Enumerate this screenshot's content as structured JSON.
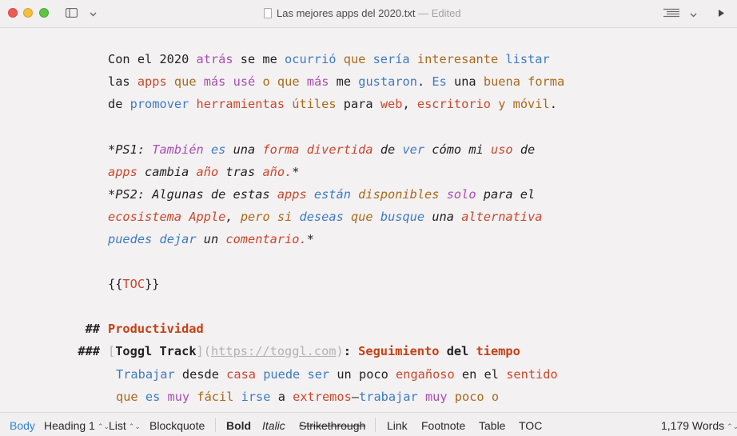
{
  "window": {
    "title": "Las mejores apps del 2020.txt",
    "title_sep": "—",
    "edited": "Edited"
  },
  "colors": {
    "purple": "#a84eb0",
    "blue": "#3c7bc0",
    "ochre": "#a86a18",
    "red": "#c9482a",
    "heading": "#c34113",
    "accent": "#2f86d6"
  },
  "editor": {
    "p1_l1": [
      {
        "t": "Con el 2020 "
      },
      {
        "t": "atrás",
        "c": "p"
      },
      {
        "t": " se me "
      },
      {
        "t": "ocurrió",
        "c": "b"
      },
      {
        "t": " "
      },
      {
        "t": "que",
        "c": "o"
      },
      {
        "t": " "
      },
      {
        "t": "sería",
        "c": "b"
      },
      {
        "t": " "
      },
      {
        "t": "interesante",
        "c": "o"
      },
      {
        "t": " "
      },
      {
        "t": "listar",
        "c": "b"
      }
    ],
    "p1_l2": [
      {
        "t": "las "
      },
      {
        "t": "apps",
        "c": "r"
      },
      {
        "t": " "
      },
      {
        "t": "que",
        "c": "o"
      },
      {
        "t": " "
      },
      {
        "t": "más",
        "c": "p"
      },
      {
        "t": " "
      },
      {
        "t": "usé",
        "c": "p"
      },
      {
        "t": " "
      },
      {
        "t": "o",
        "c": "o"
      },
      {
        "t": " "
      },
      {
        "t": "que",
        "c": "o"
      },
      {
        "t": " "
      },
      {
        "t": "más",
        "c": "p"
      },
      {
        "t": " me "
      },
      {
        "t": "gustaron",
        "c": "b"
      },
      {
        "t": ". "
      },
      {
        "t": "Es",
        "c": "b"
      },
      {
        "t": " una "
      },
      {
        "t": "buena",
        "c": "o"
      },
      {
        "t": " "
      },
      {
        "t": "forma",
        "c": "o"
      }
    ],
    "p1_l3": [
      {
        "t": "de "
      },
      {
        "t": "promover",
        "c": "b"
      },
      {
        "t": " "
      },
      {
        "t": "herramientas",
        "c": "r"
      },
      {
        "t": " "
      },
      {
        "t": "útiles",
        "c": "o"
      },
      {
        "t": " para "
      },
      {
        "t": "web",
        "c": "r"
      },
      {
        "t": ", "
      },
      {
        "t": "escritorio",
        "c": "r"
      },
      {
        "t": " "
      },
      {
        "t": "y",
        "c": "o"
      },
      {
        "t": " "
      },
      {
        "t": "móvil",
        "c": "o"
      },
      {
        "t": "."
      }
    ],
    "ps1_l1": [
      {
        "t": "*PS1: "
      },
      {
        "t": "También",
        "c": "p"
      },
      {
        "t": " "
      },
      {
        "t": "es",
        "c": "b"
      },
      {
        "t": " una "
      },
      {
        "t": "forma",
        "c": "r"
      },
      {
        "t": " "
      },
      {
        "t": "divertida",
        "c": "r"
      },
      {
        "t": " de "
      },
      {
        "t": "ver",
        "c": "b"
      },
      {
        "t": " cómo mi "
      },
      {
        "t": "uso",
        "c": "r"
      },
      {
        "t": " de"
      }
    ],
    "ps1_l2": [
      {
        "t": "apps",
        "c": "r"
      },
      {
        "t": " cambia "
      },
      {
        "t": "año",
        "c": "r"
      },
      {
        "t": " tras "
      },
      {
        "t": "año.",
        "c": "r"
      },
      {
        "t": "*"
      }
    ],
    "ps2_l1": [
      {
        "t": "*PS2: Algunas de estas "
      },
      {
        "t": "apps",
        "c": "r"
      },
      {
        "t": " "
      },
      {
        "t": "están",
        "c": "b"
      },
      {
        "t": " "
      },
      {
        "t": "disponibles",
        "c": "o"
      },
      {
        "t": " "
      },
      {
        "t": "solo",
        "c": "p"
      },
      {
        "t": " para el"
      }
    ],
    "ps2_l2": [
      {
        "t": "ecosistema",
        "c": "r"
      },
      {
        "t": " "
      },
      {
        "t": "Apple",
        "c": "r"
      },
      {
        "t": ", "
      },
      {
        "t": "pero",
        "c": "o"
      },
      {
        "t": " "
      },
      {
        "t": "si",
        "c": "o"
      },
      {
        "t": " "
      },
      {
        "t": "deseas",
        "c": "b"
      },
      {
        "t": " "
      },
      {
        "t": "que",
        "c": "o"
      },
      {
        "t": " "
      },
      {
        "t": "busque",
        "c": "b"
      },
      {
        "t": " una "
      },
      {
        "t": "alternativa",
        "c": "r"
      }
    ],
    "ps2_l3": [
      {
        "t": "puedes",
        "c": "b"
      },
      {
        "t": " "
      },
      {
        "t": "dejar",
        "c": "b"
      },
      {
        "t": " un "
      },
      {
        "t": "comentario.",
        "c": "r"
      },
      {
        "t": "*"
      }
    ],
    "toc_open": "{{",
    "toc_word": "TOC",
    "toc_close": "}}",
    "h2_marker": "##",
    "h2_text": "Productividad",
    "h3_marker": "###",
    "h3_link_open": "[",
    "h3_link_text": "Toggl Track",
    "h3_link_mid": "](",
    "h3_link_url": "https://toggl.com",
    "h3_link_close": ")",
    "h3_colon": ": ",
    "h3_w1": "Seguimiento",
    "h3_w2": "del",
    "h3_w3": "tiempo",
    "body_l1": [
      {
        "t": "Trabajar",
        "c": "b"
      },
      {
        "t": " desde "
      },
      {
        "t": "casa",
        "c": "r"
      },
      {
        "t": " "
      },
      {
        "t": "puede",
        "c": "b"
      },
      {
        "t": " "
      },
      {
        "t": "ser",
        "c": "b"
      },
      {
        "t": " un poco "
      },
      {
        "t": "engañoso",
        "c": "r"
      },
      {
        "t": " en el "
      },
      {
        "t": "sentido",
        "c": "r"
      }
    ],
    "body_l2": [
      {
        "t": "que",
        "c": "o"
      },
      {
        "t": " "
      },
      {
        "t": "es",
        "c": "b"
      },
      {
        "t": " "
      },
      {
        "t": "muy",
        "c": "p"
      },
      {
        "t": " "
      },
      {
        "t": "fácil",
        "c": "o"
      },
      {
        "t": " "
      },
      {
        "t": "irse",
        "c": "b"
      },
      {
        "t": " a "
      },
      {
        "t": "extremos",
        "c": "r"
      },
      {
        "t": "—"
      },
      {
        "t": "trabajar",
        "c": "b"
      },
      {
        "t": " "
      },
      {
        "t": "muy",
        "c": "p"
      },
      {
        "t": " "
      },
      {
        "t": "poco",
        "c": "o"
      },
      {
        "t": " "
      },
      {
        "t": "o",
        "c": "o"
      }
    ]
  },
  "bottombar": {
    "body": "Body",
    "heading": "Heading 1",
    "list": "List",
    "blockquote": "Blockquote",
    "bold": "Bold",
    "italic": "Italic",
    "strikethrough": "Strikethrough",
    "link": "Link",
    "footnote": "Footnote",
    "table": "Table",
    "toc": "TOC",
    "word_count": "1,179 Words"
  }
}
